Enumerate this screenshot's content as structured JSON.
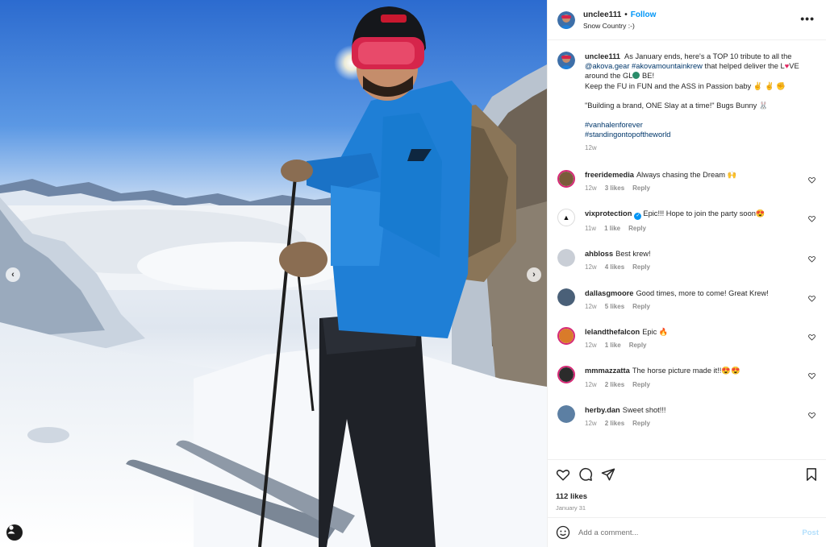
{
  "post": {
    "username": "unclee111",
    "separator": "•",
    "follow_label": "Follow",
    "location": "Snow Country :-)",
    "more_icon": "more-horizontal-icon"
  },
  "caption": {
    "username": "unclee111",
    "line1": "As January ends, here's a TOP 10 tribute to all the",
    "mention1": "@akova.gear",
    "mention2": "#akovamountainkrew",
    "line1b": "that helped deliver the L",
    "line1c": "VE",
    "line2a": "around the GL",
    "line2b": "BE!",
    "line3": "Keep the FU in FUN and the ASS in Passion baby",
    "line4": "\"Building a brand, ONE Slay at a time!\" Bugs Bunny",
    "tag1": "#vanhalenforever",
    "tag2": "#standingontopoftheworld",
    "time": "12w"
  },
  "comments": [
    {
      "username": "freeridemedia",
      "text": "Always chasing the Dream 🙌",
      "time": "12w",
      "likes": "3 likes",
      "reply": "Reply",
      "verified": false,
      "avatar_color": "#7a5c3a"
    },
    {
      "username": "vixprotection",
      "text": "Epic!!! Hope to join the party soon😍",
      "time": "11w",
      "likes": "1 like",
      "reply": "Reply",
      "verified": true,
      "avatar_color": "#ffffff"
    },
    {
      "username": "ahbloss",
      "text": "Best krew!",
      "time": "12w",
      "likes": "4 likes",
      "reply": "Reply",
      "verified": false,
      "avatar_color": "#c9ced6"
    },
    {
      "username": "dallasgmoore",
      "text": "Good times, more to come! Great Krew!",
      "time": "12w",
      "likes": "5 likes",
      "reply": "Reply",
      "verified": false,
      "avatar_color": "#4a6078"
    },
    {
      "username": "lelandthefalcon",
      "text": "Epic 🔥",
      "time": "12w",
      "likes": "1 like",
      "reply": "Reply",
      "verified": false,
      "avatar_color": "#d97b2a"
    },
    {
      "username": "mmmazzatta",
      "text": "The horse picture made it!!😍😍",
      "time": "12w",
      "likes": "2 likes",
      "reply": "Reply",
      "verified": false,
      "avatar_color": "#2b2b2b"
    },
    {
      "username": "herby.dan",
      "text": "Sweet shot!!!",
      "time": "12w",
      "likes": "2 likes",
      "reply": "Reply",
      "verified": false,
      "avatar_color": "#5c7fa3"
    }
  ],
  "footer": {
    "likes": "112 likes",
    "date": "January 31",
    "comment_placeholder": "Add a comment...",
    "post_label": "Post"
  },
  "colors": {
    "link": "#00376b",
    "follow": "#0095f6",
    "muted": "#8e8e8e",
    "jacket": "#1f7fd6"
  }
}
